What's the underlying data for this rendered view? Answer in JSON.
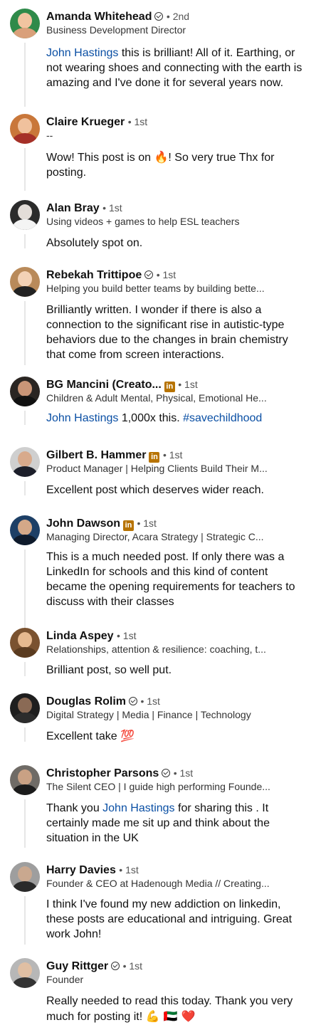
{
  "comments": [
    {
      "name": "Amanda Whitehead",
      "verified": true,
      "degree": "• 2nd",
      "headline": "Business Development Director",
      "mention": "John Hastings",
      "text": " this is brilliant! All of it. Earthing, or not wearing shoes and connecting with the earth is amazing and I've done it for several years now."
    },
    {
      "name": "Claire Krueger",
      "degree": "• 1st",
      "headline": "--",
      "text_a": "Wow!  This post is on ",
      "emoji": "🔥",
      "text_b": "!  So very true Thx for posting."
    },
    {
      "name": "Alan Bray",
      "degree": "• 1st",
      "headline": "Using videos + games to help ESL teachers",
      "text": "Absolutely spot on."
    },
    {
      "name": "Rebekah Trittipoe",
      "verified": true,
      "degree": "• 1st",
      "headline": "Helping you build better teams by building bette...",
      "text": "Brilliantly  written. I wonder if there is also a connection to the significant rise in autistic-type behaviors due to the changes in brain chemistry that come from screen interactions."
    },
    {
      "name": "BG Mancini (Creato...",
      "badge": "in",
      "degree": "• 1st",
      "headline": "Children & Adult Mental, Physical, Emotional He...",
      "mention": "John Hastings",
      "text": "  1,000x this. ",
      "hashtag": "#savechildhood"
    },
    {
      "name": "Gilbert B. Hammer",
      "badge": "in",
      "degree": "• 1st",
      "headline": "Product Manager | Helping Clients Build Their M...",
      "text": "Excellent post which deserves wider reach."
    },
    {
      "name": "John Dawson",
      "badge": "in",
      "degree": "• 1st",
      "headline": "Managing Director, Acara Strategy | Strategic C...",
      "text": "This is a much needed post. If only there was a LinkedIn for schools and this kind of content became the opening requirements for teachers to discuss with their classes"
    },
    {
      "name": "Linda Aspey",
      "degree": "• 1st",
      "headline": "Relationships, attention & resilience: coaching, t...",
      "text": "Brilliant post, so well put."
    },
    {
      "name": "Douglas Rolim",
      "verified": true,
      "degree": "• 1st",
      "headline": "Digital Strategy | Media | Finance | Technology",
      "text": "Excellent take ",
      "emoji": "💯"
    },
    {
      "name": "Christopher Parsons",
      "verified": true,
      "degree": "• 1st",
      "headline": "The Silent CEO | I guide high performing Founde...",
      "text_a": "Thank you ",
      "mention": "John Hastings",
      "text_b": " for sharing this . It certainly made me sit up and think about the situation in the UK"
    },
    {
      "name": "Harry Davies",
      "degree": "• 1st",
      "headline": "Founder & CEO at Hadenough Media // Creating...",
      "text": "I think I've found my new addiction on linkedin, these posts are educational and intriguing. Great work John!"
    },
    {
      "name": "Guy Rittger",
      "verified": true,
      "degree": "• 1st",
      "headline": "Founder",
      "text": "Really needed to read this today. Thank you very much for posting it! ",
      "emoji": "💪 🇦🇪 ❤️"
    }
  ],
  "colors": {
    "mention": "#0a4fa4",
    "badge": "#b77300",
    "thread": "#e6e6e6"
  }
}
